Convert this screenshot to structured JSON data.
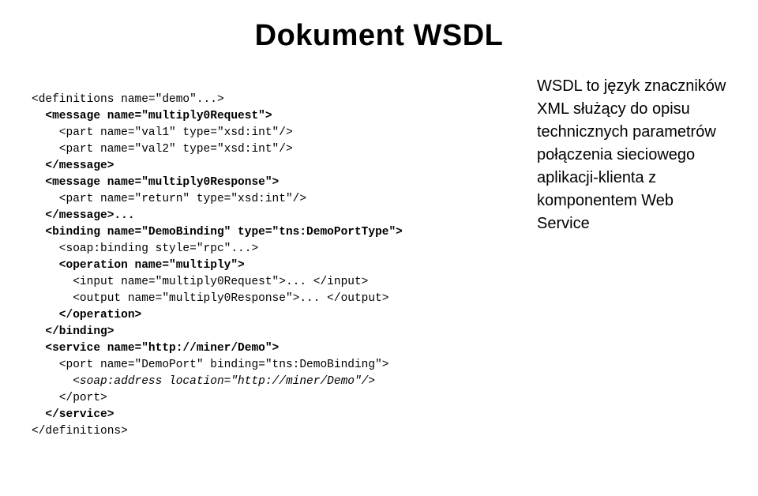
{
  "title": "Dokument WSDL",
  "code": {
    "l01": "<definitions name=\"demo\"...>",
    "l02": "  <message name=\"multiply0Request\">",
    "l03": "    <part name=\"val1\" type=\"xsd:int\"/>",
    "l04": "    <part name=\"val2\" type=\"xsd:int\"/>",
    "l05": "  </message>",
    "l06": "  <message name=\"multiply0Response\">",
    "l07": "    <part name=\"return\" type=\"xsd:int\"/>",
    "l08": "  </message>...",
    "l09": "  <binding name=\"DemoBinding\" type=\"tns:DemoPortType\">",
    "l10": "    <soap:binding style=\"rpc\"...>",
    "l11": "    <operation name=\"multiply\">",
    "l12": "      <input name=\"multiply0Request\">... </input>",
    "l13": "      <output name=\"multiply0Response\">... </output>",
    "l14": "    </operation>",
    "l15": "  </binding>",
    "l16": "  <service name=\"http://miner/Demo\">",
    "l17": "    <port name=\"DemoPort\" binding=\"tns:DemoBinding\">",
    "l18": "      <soap:address location=\"http://miner/Demo\"/>",
    "l19": "    </port>",
    "l20": "  </service>",
    "l21": "</definitions>"
  },
  "side": "WSDL to język znaczników XML służący do opisu technicznych parametrów połączenia sieciowego aplikacji-klienta z komponentem Web Service"
}
